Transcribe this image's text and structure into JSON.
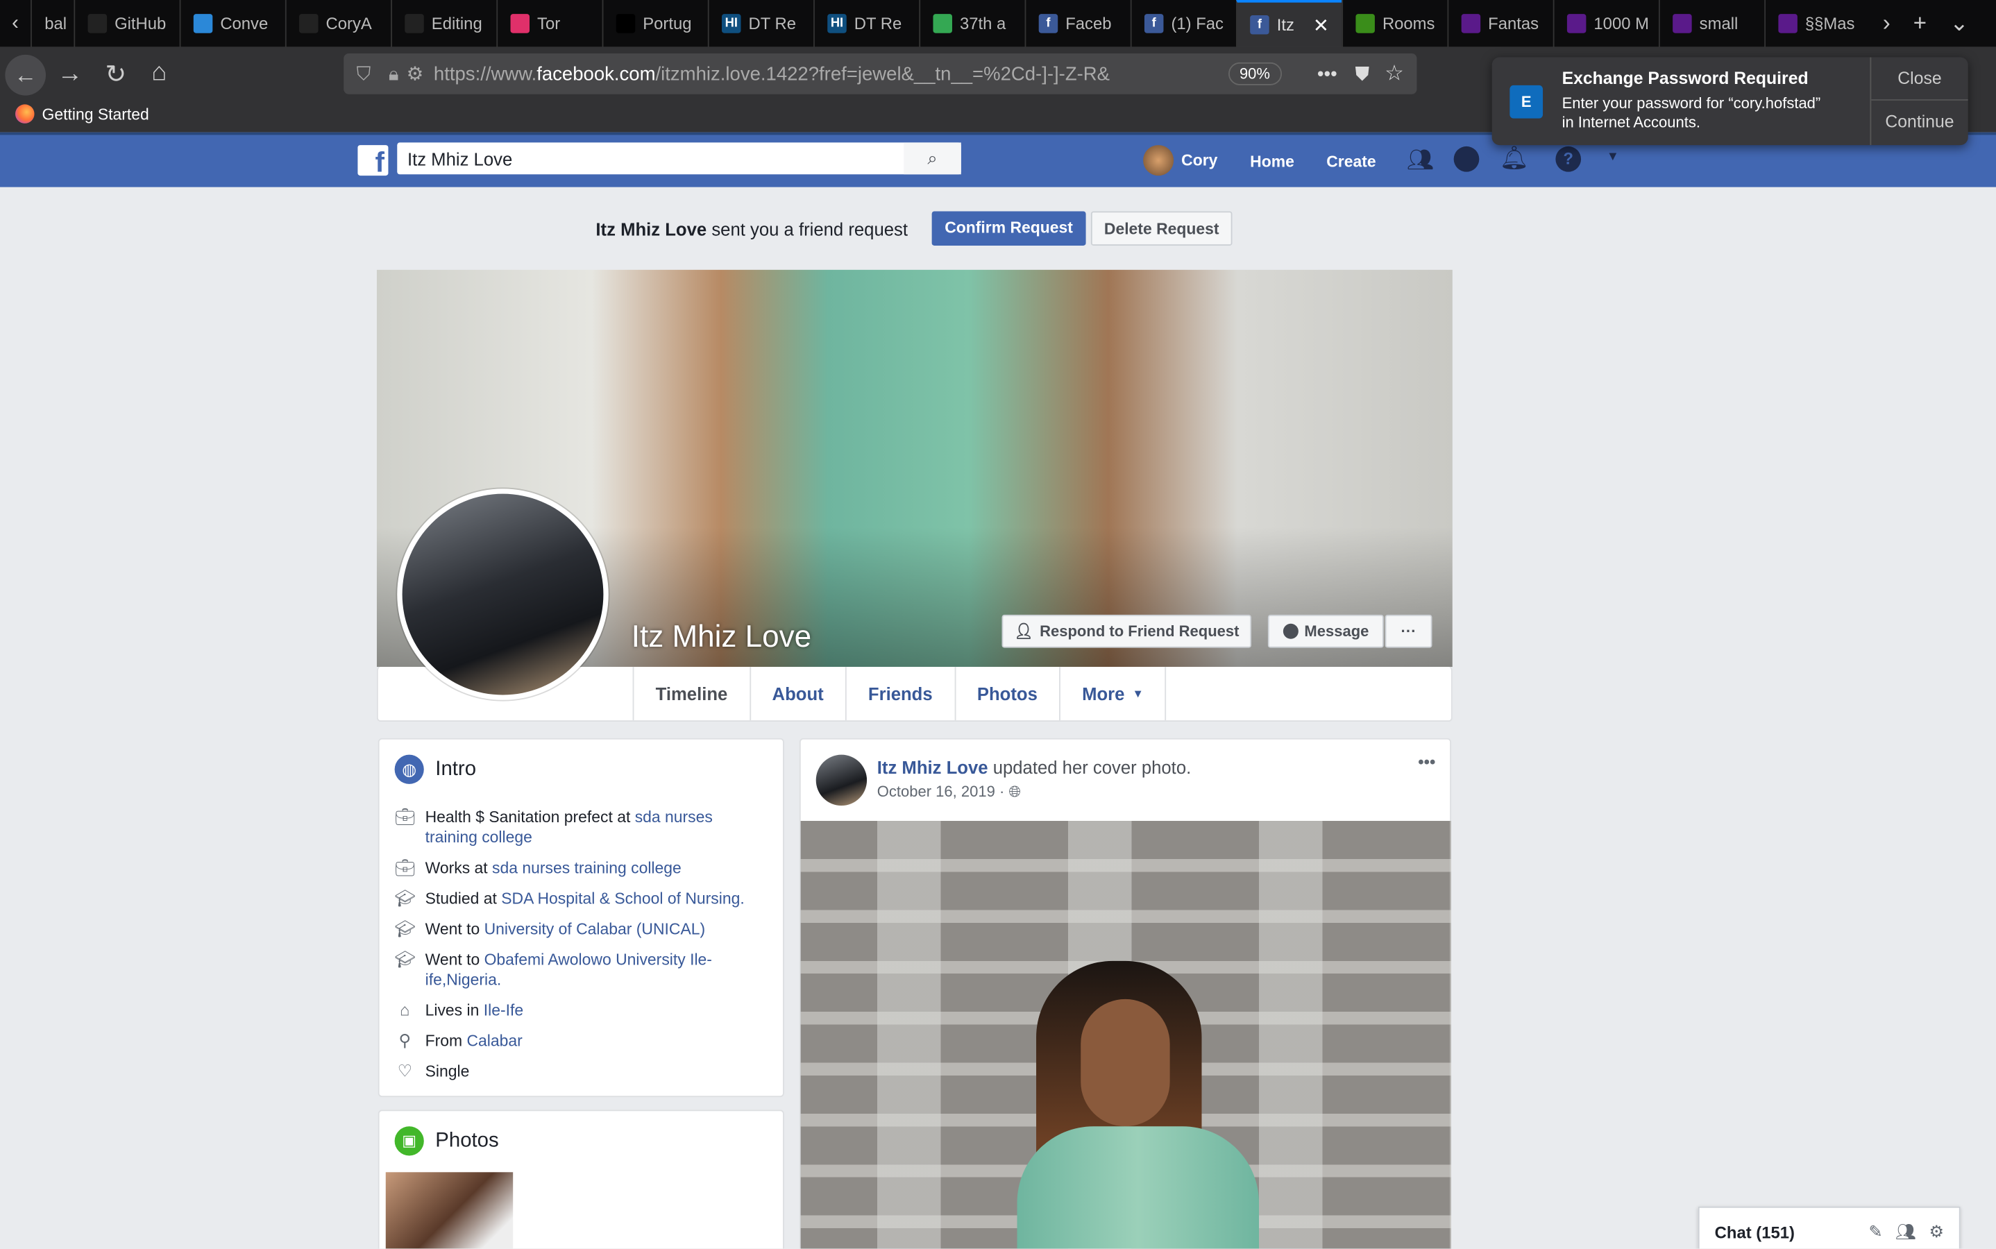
{
  "browser": {
    "tabs": [
      {
        "label": "bal",
        "icon": "globe-icon",
        "color": "#333"
      },
      {
        "label": "GitHub",
        "icon": "github-icon",
        "color": "#222"
      },
      {
        "label": "Conve",
        "icon": "onedrive-icon",
        "color": "#2b88d8"
      },
      {
        "label": "CoryA",
        "icon": "github-icon",
        "color": "#222"
      },
      {
        "label": "Editing",
        "icon": "github-icon",
        "color": "#222"
      },
      {
        "label": "Tor",
        "icon": "patreon-icon",
        "color": "#e0306a"
      },
      {
        "label": "Portug",
        "icon": "notion-icon",
        "color": "#000"
      },
      {
        "label": "DT Re",
        "icon": "hi-icon",
        "color": "#0f4f7f"
      },
      {
        "label": "DT Re",
        "icon": "hi-icon",
        "color": "#0f4f7f"
      },
      {
        "label": "37th a",
        "icon": "maps-pin-icon",
        "color": "#34a853"
      },
      {
        "label": "Faceb",
        "icon": "facebook-icon",
        "color": "#3b5998"
      },
      {
        "label": "(1) Fac",
        "icon": "facebook-icon",
        "color": "#3b5998"
      },
      {
        "label": "Itz",
        "icon": "facebook-icon",
        "color": "#3b5998",
        "active": true
      },
      {
        "label": "Rooms",
        "icon": "rooms-icon",
        "color": "#3a8d1a"
      },
      {
        "label": "Fantas",
        "icon": "peace-icon",
        "color": "#5a1a8a"
      },
      {
        "label": "1000 M",
        "icon": "peace-icon",
        "color": "#5a1a8a"
      },
      {
        "label": "small",
        "icon": "peace-icon",
        "color": "#5a1a8a"
      },
      {
        "label": "§§Mas",
        "icon": "peace-icon",
        "color": "#5a1a8a"
      }
    ],
    "url_prefix": "https://www.",
    "url_host": "facebook.com",
    "url_rest": "/itzmhiz.love.1422?fref=jewel&__tn__=%2Cd-]-]-Z-R&",
    "zoom": "90%",
    "bookmark": "Getting Started"
  },
  "notification": {
    "title": "Exchange Password Required",
    "body1": "Enter your password for “cory.hofstad”",
    "body2": "in Internet Accounts.",
    "close": "Close",
    "continue": "Continue"
  },
  "fb": {
    "search_value": "Itz Mhiz Love",
    "user": "Cory",
    "home": "Home",
    "create": "Create",
    "friend_request": {
      "name": "Itz Mhiz Love",
      "text": " sent you a friend request",
      "confirm": "Confirm Request",
      "delete": "Delete Request"
    },
    "profile": {
      "name": "Itz Mhiz Love",
      "respond": "Respond to Friend Request",
      "message": "Message",
      "more_dots": "···"
    },
    "tabs": [
      "Timeline",
      "About",
      "Friends",
      "Photos",
      "More"
    ],
    "intro": {
      "title": "Intro",
      "rows": [
        {
          "icon": "briefcase-icon",
          "text": "Health $ Sanitation prefect at ",
          "link": "sda nurses training college"
        },
        {
          "icon": "briefcase-icon",
          "text": "Works at ",
          "link": "sda nurses training college"
        },
        {
          "icon": "graduation-cap-icon",
          "text": "Studied at ",
          "link": "SDA Hospital & School of Nursing."
        },
        {
          "icon": "graduation-cap-icon",
          "text": "Went to ",
          "link": "University of Calabar (UNICAL)"
        },
        {
          "icon": "graduation-cap-icon",
          "text": "Went to ",
          "link": "Obafemi Awolowo University Ile-ife,Nigeria."
        },
        {
          "icon": "home-icon",
          "text": "Lives in ",
          "link": "Ile-Ife"
        },
        {
          "icon": "location-pin-icon",
          "text": "From ",
          "link": "Calabar"
        },
        {
          "icon": "heart-icon",
          "text": "Single",
          "link": ""
        }
      ]
    },
    "photos_title": "Photos",
    "post": {
      "author": "Itz Mhiz Love",
      "action": " updated her cover photo.",
      "date": "October 16, 2019 · "
    },
    "chat": "Chat (151)"
  }
}
